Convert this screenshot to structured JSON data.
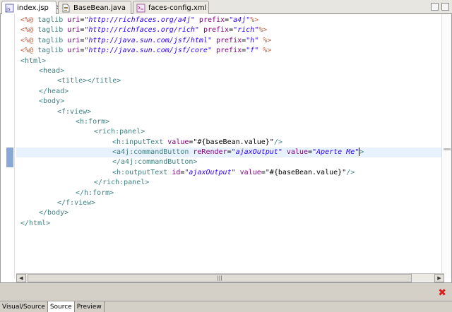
{
  "tabs": [
    {
      "label": "index.jsp",
      "icon": "jsp-file-icon",
      "active": true,
      "closable": true
    },
    {
      "label": "BaseBean.java",
      "icon": "java-file-icon",
      "active": false,
      "closable": false
    },
    {
      "label": "faces-config.xml",
      "icon": "xml-file-icon",
      "active": false,
      "closable": false
    }
  ],
  "close_glyph": "✕",
  "code_lines": [
    {
      "indent": 0,
      "current": false,
      "tokens": [
        [
          "dir",
          "<%@ "
        ],
        [
          "tag",
          "taglib "
        ],
        [
          "attr",
          "uri"
        ],
        [
          "plain",
          "="
        ],
        [
          "str",
          "\"http://richfaces.org/a4j\""
        ],
        [
          "plain",
          " "
        ],
        [
          "attr",
          "prefix"
        ],
        [
          "plain",
          "="
        ],
        [
          "str",
          "\"a4j\""
        ],
        [
          "pct",
          "%>"
        ]
      ]
    },
    {
      "indent": 0,
      "current": false,
      "tokens": [
        [
          "dir",
          "<%@ "
        ],
        [
          "tag",
          "taglib "
        ],
        [
          "attr",
          "uri"
        ],
        [
          "plain",
          "="
        ],
        [
          "str",
          "\"http://richfaces.org/rich\""
        ],
        [
          "plain",
          " "
        ],
        [
          "attr",
          "prefix"
        ],
        [
          "plain",
          "="
        ],
        [
          "str",
          "\"rich\""
        ],
        [
          "pct",
          "%>"
        ]
      ]
    },
    {
      "indent": 0,
      "current": false,
      "tokens": [
        [
          "dir",
          "<%@ "
        ],
        [
          "tag",
          "taglib "
        ],
        [
          "attr",
          "uri"
        ],
        [
          "plain",
          "="
        ],
        [
          "str",
          "\"http://java.sun.com/jsf/html\""
        ],
        [
          "plain",
          " "
        ],
        [
          "attr",
          "prefix"
        ],
        [
          "plain",
          "="
        ],
        [
          "str",
          "\"h\""
        ],
        [
          "plain",
          " "
        ],
        [
          "pct",
          "%>"
        ]
      ]
    },
    {
      "indent": 0,
      "current": false,
      "tokens": [
        [
          "dir",
          "<%@ "
        ],
        [
          "tag",
          "taglib "
        ],
        [
          "attr",
          "uri"
        ],
        [
          "plain",
          "="
        ],
        [
          "str",
          "\"http://java.sun.com/jsf/core\""
        ],
        [
          "plain",
          " "
        ],
        [
          "attr",
          "prefix"
        ],
        [
          "plain",
          "="
        ],
        [
          "str",
          "\"f\""
        ],
        [
          "plain",
          " "
        ],
        [
          "pct",
          "%>"
        ]
      ]
    },
    {
      "indent": 0,
      "current": false,
      "tokens": [
        [
          "tag",
          "<html>"
        ]
      ]
    },
    {
      "indent": 1,
      "current": false,
      "tokens": [
        [
          "tag",
          "<head>"
        ]
      ]
    },
    {
      "indent": 2,
      "current": false,
      "tokens": [
        [
          "tag",
          "<title></title>"
        ]
      ]
    },
    {
      "indent": 1,
      "current": false,
      "tokens": [
        [
          "tag",
          "</head>"
        ]
      ]
    },
    {
      "indent": 1,
      "current": false,
      "tokens": [
        [
          "tag",
          "<body>"
        ]
      ]
    },
    {
      "indent": 2,
      "current": false,
      "tokens": [
        [
          "tag",
          "<f:view>"
        ]
      ]
    },
    {
      "indent": 3,
      "current": false,
      "tokens": [
        [
          "tag",
          "<h:form>"
        ]
      ]
    },
    {
      "indent": 4,
      "current": false,
      "tokens": [
        [
          "tag",
          "<rich:panel>"
        ]
      ]
    },
    {
      "indent": 5,
      "current": false,
      "tokens": [
        [
          "tag",
          "<h:inputText "
        ],
        [
          "attr",
          "value"
        ],
        [
          "plain",
          "=\"#{baseBean.value}\""
        ],
        [
          "tag",
          "/>"
        ]
      ]
    },
    {
      "indent": 5,
      "current": true,
      "tokens": [
        [
          "tag",
          "<a4j:commandButton "
        ],
        [
          "attr",
          "reRender"
        ],
        [
          "plain",
          "="
        ],
        [
          "str",
          "\"ajaxOutput\""
        ],
        [
          "plain",
          " "
        ],
        [
          "attr",
          "value"
        ],
        [
          "plain",
          "="
        ],
        [
          "str",
          "\"Aperte Me\""
        ],
        [
          "caret",
          ""
        ],
        [
          "tag",
          ">"
        ]
      ]
    },
    {
      "indent": 5,
      "current": false,
      "tokens": [
        [
          "tag",
          "</a4j:commandButton>"
        ]
      ]
    },
    {
      "indent": 5,
      "current": false,
      "tokens": [
        [
          "tag",
          "<h:outputText "
        ],
        [
          "attr",
          "id"
        ],
        [
          "plain",
          "="
        ],
        [
          "str",
          "\"ajaxOutput\""
        ],
        [
          "plain",
          " "
        ],
        [
          "attr",
          "value"
        ],
        [
          "plain",
          "=\"#{baseBean.value}\""
        ],
        [
          "tag",
          "/>"
        ]
      ]
    },
    {
      "indent": 4,
      "current": false,
      "tokens": [
        [
          "tag",
          "</rich:panel>"
        ]
      ]
    },
    {
      "indent": 3,
      "current": false,
      "tokens": [
        [
          "tag",
          "</h:form>"
        ]
      ]
    },
    {
      "indent": 2,
      "current": false,
      "tokens": [
        [
          "tag",
          "</f:view>"
        ]
      ]
    },
    {
      "indent": 1,
      "current": false,
      "tokens": [
        [
          "tag",
          "</body>"
        ]
      ]
    },
    {
      "indent": 0,
      "current": false,
      "tokens": [
        [
          "tag",
          "</html>"
        ]
      ]
    }
  ],
  "scrollbar": {
    "left_arrow": "◀",
    "right_arrow": "▶",
    "thumb_grip": "|||"
  },
  "error_glyph": "✖",
  "mode_tabs": [
    {
      "label": "Visual/Source",
      "active": false
    },
    {
      "label": "Source",
      "active": true
    },
    {
      "label": "Preview",
      "active": false
    }
  ],
  "colors": {
    "directive": "#bf5f3f",
    "tag": "#3f7f7f",
    "attribute": "#7f007f",
    "string": "#2a00ff",
    "current_line": "#e8f2fe",
    "error": "#d8201d"
  }
}
